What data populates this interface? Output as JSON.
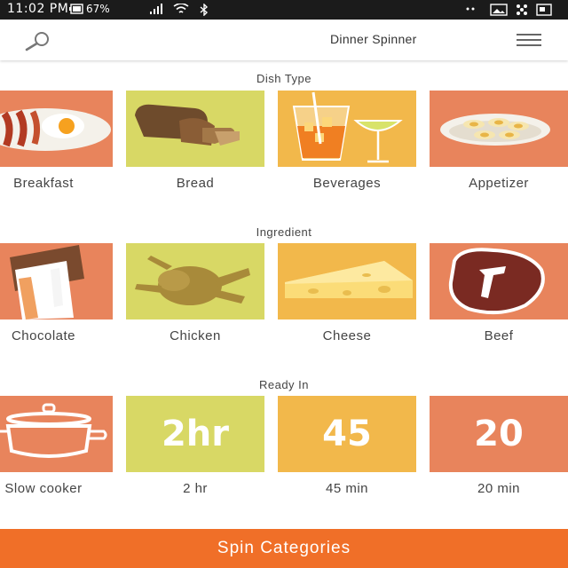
{
  "status_bar": {
    "time": "11:02 PM",
    "battery": "67%",
    "icons": [
      "battery-icon",
      "signal-icon",
      "wifi-icon",
      "bluetooth-icon",
      "photo-icon",
      "pinwheel-icon",
      "dots-icon"
    ]
  },
  "app_bar": {
    "title": "Dinner Spinner",
    "search_icon": "search-icon",
    "menu_icon": "menu-icon"
  },
  "sections": [
    {
      "heading": "Dish Type",
      "tiles": [
        {
          "label": "Appetizer",
          "color": "#e8845c",
          "icon": "appetizer-icon"
        },
        {
          "label": "Beverages",
          "color": "#f2b84b",
          "icon": "beverages-icon"
        },
        {
          "label": "Bread",
          "color": "#d8d865",
          "icon": "bread-icon"
        },
        {
          "label": "Breakfast",
          "color": "#e8845c",
          "icon": "breakfast-icon"
        }
      ]
    },
    {
      "heading": "Ingredient",
      "tiles": [
        {
          "label": "Beef",
          "color": "#e8845c",
          "icon": "beef-icon"
        },
        {
          "label": "Cheese",
          "color": "#f2b84b",
          "icon": "cheese-icon"
        },
        {
          "label": "Chicken",
          "color": "#d8d865",
          "icon": "chicken-icon"
        },
        {
          "label": "Chocolate",
          "color": "#e8845c",
          "icon": "chocolate-icon"
        }
      ]
    },
    {
      "heading": "Ready In",
      "tiles": [
        {
          "label": "20 min",
          "big": "20",
          "color": "#e8845c",
          "icon": "number-20"
        },
        {
          "label": "45 min",
          "big": "45",
          "color": "#f2b84b",
          "icon": "number-45"
        },
        {
          "label": "2 hr",
          "big": "2hr",
          "color": "#d8d865",
          "icon": "number-2hr"
        },
        {
          "label": "Slow cooker",
          "color": "#e8845c",
          "icon": "slow-cooker-icon"
        }
      ]
    }
  ],
  "spin_button": {
    "label": "Spin Categories",
    "color": "#f06f28"
  },
  "colors": {
    "status_bar": "#1b1b1b",
    "app_bar": "#ffffff",
    "accent": "#f06f28"
  }
}
